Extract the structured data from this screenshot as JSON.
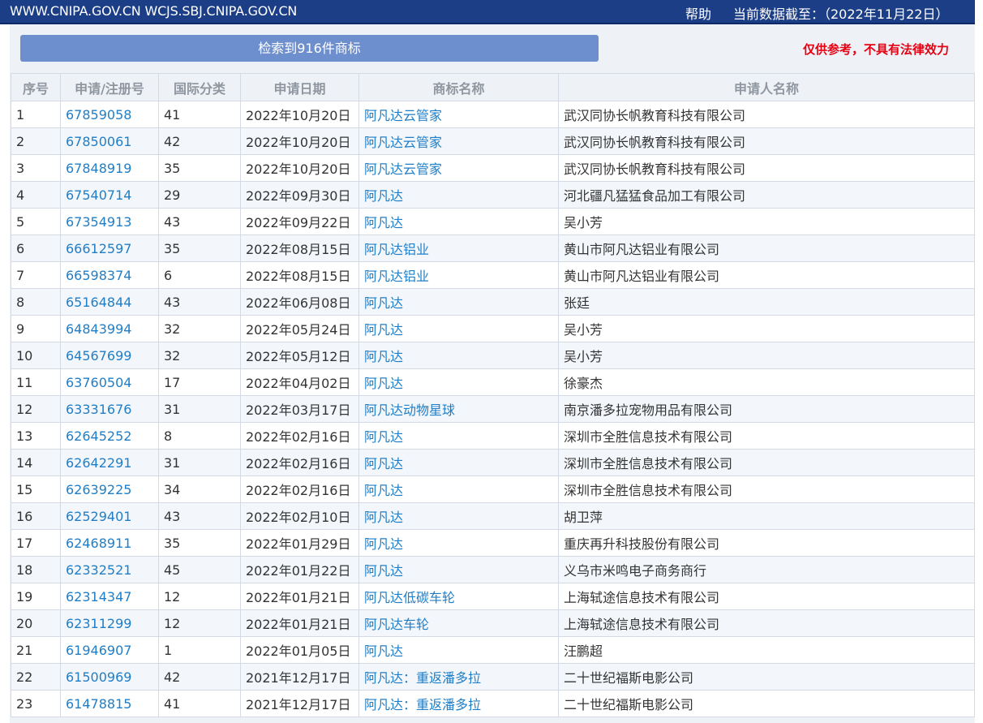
{
  "topbar": {
    "site": "WWW.CNIPA.GOV.CN WCJS.SBJ.CNIPA.GOV.CN",
    "help": "帮助",
    "as_of": "当前数据截至：（2022年11月22日）"
  },
  "result_label": "检索到916件商标",
  "disclaimer": "仅供参考，不具有法律效力",
  "table": {
    "headers": [
      "序号",
      "申请/注册号",
      "国际分类",
      "申请日期",
      "商标名称",
      "申请人名称"
    ],
    "rows": [
      [
        "1",
        "67859058",
        "41",
        "2022年10月20日",
        "阿凡达云管家",
        "武汉同协长帆教育科技有限公司"
      ],
      [
        "2",
        "67850061",
        "42",
        "2022年10月20日",
        "阿凡达云管家",
        "武汉同协长帆教育科技有限公司"
      ],
      [
        "3",
        "67848919",
        "35",
        "2022年10月20日",
        "阿凡达云管家",
        "武汉同协长帆教育科技有限公司"
      ],
      [
        "4",
        "67540714",
        "29",
        "2022年09月30日",
        "阿凡达",
        "河北疆凡猛猛食品加工有限公司"
      ],
      [
        "5",
        "67354913",
        "43",
        "2022年09月22日",
        "阿凡达",
        "吴小芳"
      ],
      [
        "6",
        "66612597",
        "35",
        "2022年08月15日",
        "阿凡达铝业",
        "黄山市阿凡达铝业有限公司"
      ],
      [
        "7",
        "66598374",
        "6",
        "2022年08月15日",
        "阿凡达铝业",
        "黄山市阿凡达铝业有限公司"
      ],
      [
        "8",
        "65164844",
        "43",
        "2022年06月08日",
        "阿凡达",
        "张廷"
      ],
      [
        "9",
        "64843994",
        "32",
        "2022年05月24日",
        "阿凡达",
        "吴小芳"
      ],
      [
        "10",
        "64567699",
        "32",
        "2022年05月12日",
        "阿凡达",
        "吴小芳"
      ],
      [
        "11",
        "63760504",
        "17",
        "2022年04月02日",
        "阿凡达",
        "徐豪杰"
      ],
      [
        "12",
        "63331676",
        "31",
        "2022年03月17日",
        "阿凡达动物星球",
        "南京潘多拉宠物用品有限公司"
      ],
      [
        "13",
        "62645252",
        "8",
        "2022年02月16日",
        "阿凡达",
        "深圳市全胜信息技术有限公司"
      ],
      [
        "14",
        "62642291",
        "31",
        "2022年02月16日",
        "阿凡达",
        "深圳市全胜信息技术有限公司"
      ],
      [
        "15",
        "62639225",
        "34",
        "2022年02月16日",
        "阿凡达",
        "深圳市全胜信息技术有限公司"
      ],
      [
        "16",
        "62529401",
        "43",
        "2022年02月10日",
        "阿凡达",
        "胡卫萍"
      ],
      [
        "17",
        "62468911",
        "35",
        "2022年01月29日",
        "阿凡达",
        "重庆再升科技股份有限公司"
      ],
      [
        "18",
        "62332521",
        "45",
        "2022年01月22日",
        "阿凡达",
        "义乌市米鸣电子商务商行"
      ],
      [
        "19",
        "62314347",
        "12",
        "2022年01月21日",
        "阿凡达低碳车轮",
        "上海轼途信息技术有限公司"
      ],
      [
        "20",
        "62311299",
        "12",
        "2022年01月21日",
        "阿凡达车轮",
        "上海轼途信息技术有限公司"
      ],
      [
        "21",
        "61946907",
        "1",
        "2022年01月05日",
        "阿凡达",
        "汪鹏超"
      ],
      [
        "22",
        "61500969",
        "42",
        "2021年12月17日",
        "阿凡达：重返潘多拉",
        "二十世纪福斯电影公司"
      ],
      [
        "23",
        "61478815",
        "41",
        "2021年12月17日",
        "阿凡达：重返潘多拉",
        "二十世纪福斯电影公司"
      ]
    ]
  }
}
